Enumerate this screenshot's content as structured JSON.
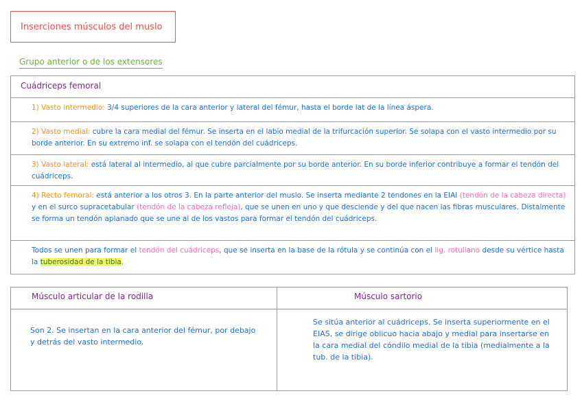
{
  "title": "Inserciones músculos del muslo",
  "subtitle": "Grupo anterior o de los extensores",
  "table1": {
    "header": "Cuádriceps femoral",
    "rows": [
      [
        {
          "c": "o",
          "t": "1) Vasto intermedio: "
        },
        {
          "c": "b",
          "t": "3/4 superiores de la cara anterior y lateral del fémur, hasta el borde lat de la línea áspera."
        }
      ],
      [
        {
          "c": "o",
          "t": "2) Vasto medial: "
        },
        {
          "c": "b",
          "t": "cubre la cara medial del fémur. Se inserta en el labio medial de la trifurcación superior. Se solapa con el vasto intermedio por su borde anterior. En su extremo inf. se solapa con el tendón del cuádriceps."
        }
      ],
      [
        {
          "c": "o",
          "t": "3) Vasto lateral: "
        },
        {
          "c": "b",
          "t": "está lateral al intermedio, al que cubre parcialmente por su borde anterior. En su borde inferior contribuye a formar el tendón del cuádriceps."
        }
      ],
      [
        {
          "c": "o",
          "t": "4) Recto femoral: "
        },
        {
          "c": "b",
          "t": "está anterior a los otros 3. En la parte anterior del muslo. Se inserta mediante 2 tendones en la EIAI "
        },
        {
          "c": "p",
          "t": "(tendón de la cabeza directa)"
        },
        {
          "c": "b",
          "t": " y en el surco supracetabular "
        },
        {
          "c": "p",
          "t": "(tendón de la cabeza refleja)"
        },
        {
          "c": "b",
          "t": ", que se unen en uno y que desciende y del que nacen las fibras musculares. Distalmente se forma un tendón aplanado que se une al de los vastos para formar el tendón del cuádriceps."
        }
      ],
      [
        {
          "c": "b",
          "t": "Todos se unen para formar el "
        },
        {
          "c": "p",
          "t": "tendón del cuádriceps"
        },
        {
          "c": "b",
          "t": ", que se inserta en la base de la rótula y se continúa con el "
        },
        {
          "c": "p",
          "t": "lig. rotuliano"
        },
        {
          "c": "b",
          "t": " desde su vértice hasta la "
        },
        {
          "c": "h",
          "t": "tuberosidad de la tibia"
        },
        {
          "c": "b",
          "t": "."
        }
      ]
    ]
  },
  "table2": {
    "col1_header": "Músculo articular de la rodilla",
    "col2_header": "Músculo sartorio",
    "col1_text": "Son 2. Se insertan en la cara anterior del fémur, por debajo y detrás del vasto intermedio.",
    "col2_text": "Se sitúa anterior al cuádriceps. Se inserta superiormente en el EIAS, se dirige oblicuo hacia abajo y medial para insertarse en la cara medial del cóndilo medial de la tibia (medialmente a la tub. de la tibia)."
  }
}
